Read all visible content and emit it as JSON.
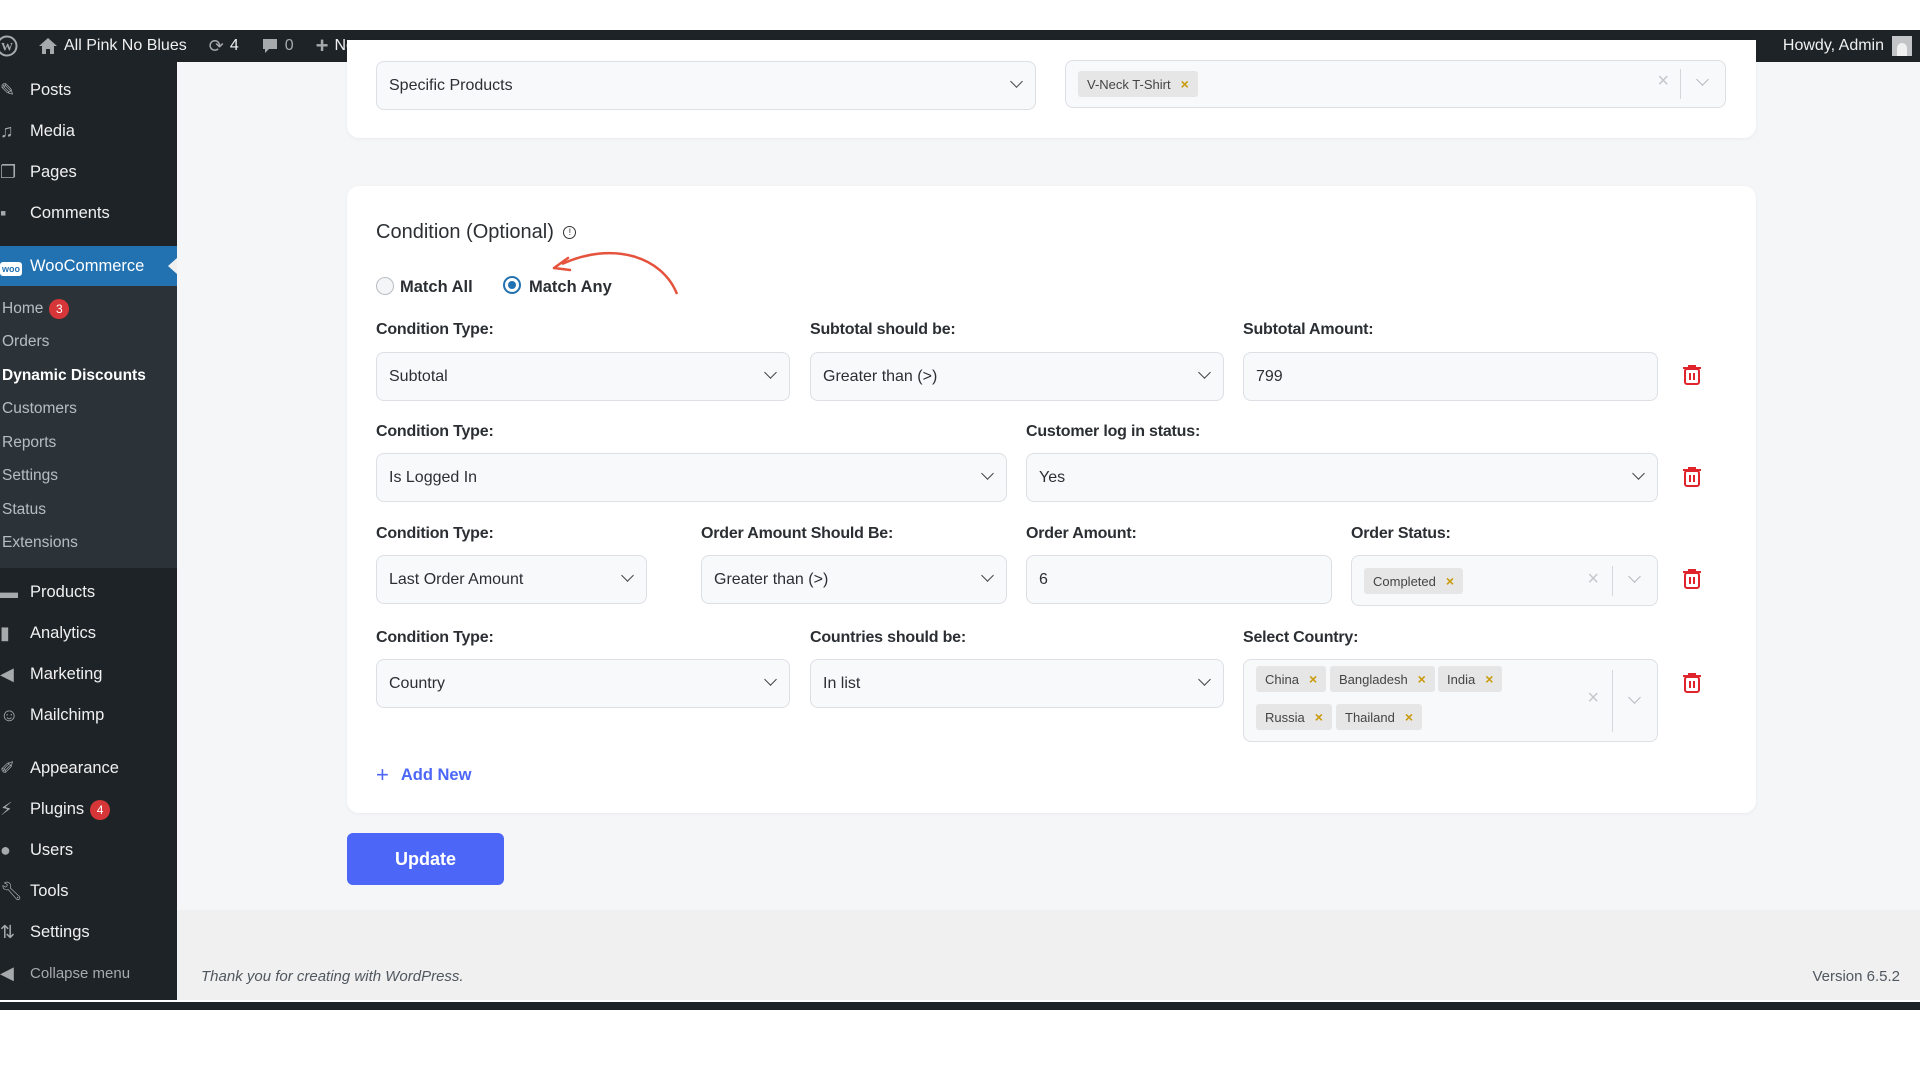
{
  "admin_bar": {
    "site_name": "All Pink No Blues",
    "updates_count": "4",
    "comments_count": "0",
    "new_label": "New",
    "greeting": "Howdy, Admin"
  },
  "sidebar": {
    "top_items": [
      {
        "label": "Posts",
        "icon": "pin-icon"
      },
      {
        "label": "Media",
        "icon": "media-icon"
      },
      {
        "label": "Pages",
        "icon": "pages-icon"
      },
      {
        "label": "Comments",
        "icon": "comment-icon"
      }
    ],
    "woocommerce": {
      "label": "WooCommerce",
      "submenu": [
        {
          "label": "Home",
          "badge": "3"
        },
        {
          "label": "Orders"
        },
        {
          "label": "Dynamic Discounts",
          "current": true
        },
        {
          "label": "Customers"
        },
        {
          "label": "Reports"
        },
        {
          "label": "Settings"
        },
        {
          "label": "Status"
        },
        {
          "label": "Extensions"
        }
      ]
    },
    "bottom_items": [
      {
        "label": "Products"
      },
      {
        "label": "Analytics"
      },
      {
        "label": "Marketing"
      },
      {
        "label": "Mailchimp"
      },
      {
        "label": "Appearance"
      },
      {
        "label": "Plugins",
        "badge": "4"
      },
      {
        "label": "Users"
      },
      {
        "label": "Tools"
      },
      {
        "label": "Settings"
      }
    ],
    "collapse_label": "Collapse menu"
  },
  "products_card": {
    "apply_to": "Specific Products",
    "selected_products": [
      "V-Neck T-Shirt"
    ]
  },
  "conditions": {
    "title": "Condition (Optional)",
    "match_options": [
      {
        "label": "Match All",
        "checked": false
      },
      {
        "label": "Match Any",
        "checked": true
      }
    ],
    "rows": [
      {
        "type_label": "Condition Type:",
        "type_value": "Subtotal",
        "op_label": "Subtotal should be:",
        "op_value": "Greater than (>)",
        "value_label": "Subtotal Amount:",
        "value": "799"
      },
      {
        "type_label": "Condition Type:",
        "type_value": "Is Logged In",
        "op_label": "Customer log in status:",
        "op_value": "Yes"
      },
      {
        "type_label": "Condition Type:",
        "type_value": "Last Order Amount",
        "op_label": "Order Amount Should Be:",
        "op_value": "Greater than (>)",
        "value_label": "Order Amount:",
        "value": "6",
        "extra_label": "Order Status:",
        "extra_tags": [
          "Completed"
        ]
      },
      {
        "type_label": "Condition Type:",
        "type_value": "Country",
        "op_label": "Countries should be:",
        "op_value": "In list",
        "value_label": "Select Country:",
        "tags": [
          "China",
          "Bangladesh",
          "India",
          "Russia",
          "Thailand"
        ]
      }
    ],
    "add_new_label": "Add New"
  },
  "update_label": "Update",
  "footer": {
    "thanks": "Thank you for creating with WordPress.",
    "version": "Version 6.5.2"
  },
  "colors": {
    "accent": "#4c66f7",
    "wp_blue": "#2271b1",
    "danger": "#e0242b",
    "tag_x": "#c99a0a"
  }
}
